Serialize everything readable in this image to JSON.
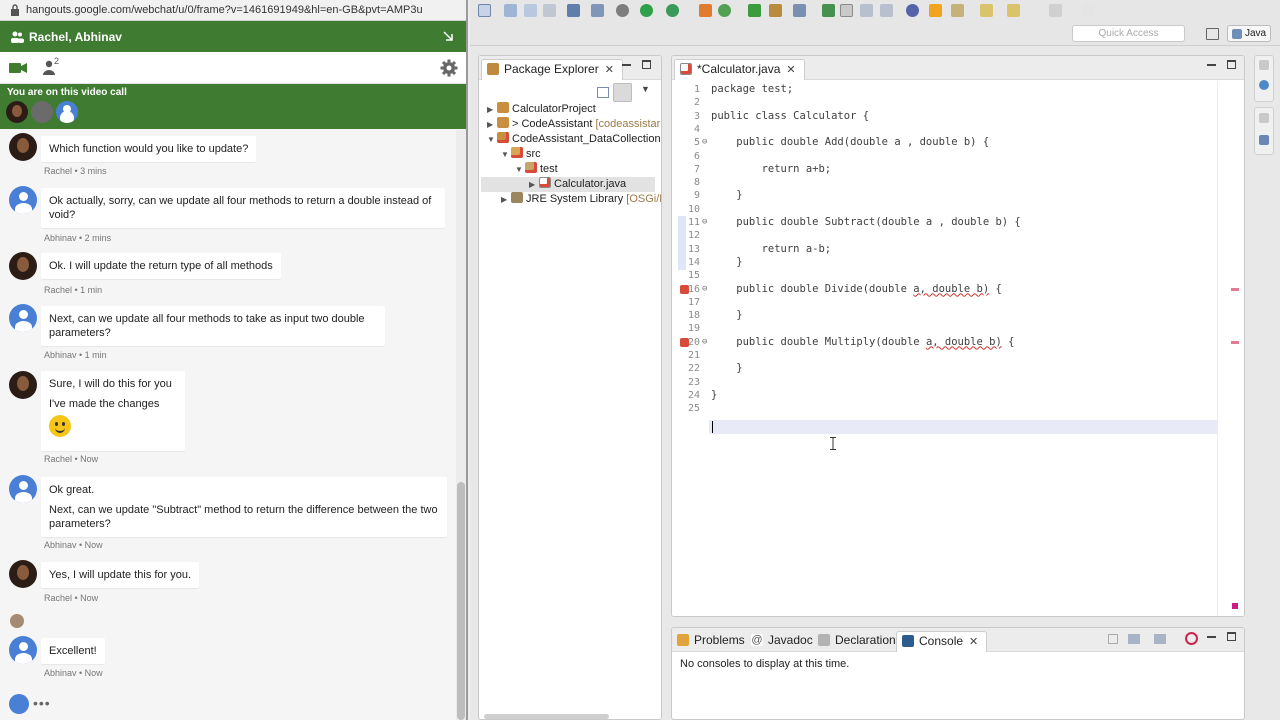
{
  "browser": {
    "url": "hangouts.google.com/webchat/u/0/frame?v=1461691949&hl=en-GB&pvt=AMP3u"
  },
  "hangouts": {
    "header_title": "Rachel, Abhinav",
    "participant_count": "2",
    "call_banner": "You are on this video call",
    "messages": [
      {
        "sender": "Rachel",
        "lines": [
          "Which function would you like to update?"
        ],
        "meta": "Rachel • 3 mins"
      },
      {
        "sender": "Abhinav",
        "lines": [
          "Ok actually, sorry, can we update all four methods to return a double instead of void?"
        ],
        "meta": "Abhinav • 2 mins"
      },
      {
        "sender": "Rachel",
        "lines": [
          "Ok. I will update the return type of all methods"
        ],
        "meta": "Rachel • 1 min"
      },
      {
        "sender": "Abhinav",
        "lines": [
          "Next, can we update all four methods to take as input two double parameters?"
        ],
        "meta": "Abhinav • 1 min"
      },
      {
        "sender": "Rachel",
        "lines": [
          "Sure, I will do this for you",
          "I've made the changes"
        ],
        "meta": "Rachel • Now"
      },
      {
        "sender": "Abhinav",
        "lines": [
          "Ok great.",
          "Next, can we update \"Subtract\" method to return the difference between the two parameters?"
        ],
        "meta": "Abhinav • Now"
      },
      {
        "sender": "Rachel",
        "lines": [
          "Yes, I will update this for you."
        ],
        "meta": "Rachel • Now"
      },
      {
        "sender": "Abhinav",
        "lines": [
          "Excellent!"
        ],
        "meta": "Abhinav • Now"
      }
    ],
    "typing_indicator": "•••"
  },
  "eclipse": {
    "quick_access_placeholder": "Quick Access",
    "perspective": "Java",
    "package_explorer": {
      "title": "Package Explorer",
      "tree": [
        {
          "label": "CalculatorProject",
          "decoration": ""
        },
        {
          "label": "> CodeAssistant",
          "decoration": "[codeassistar"
        },
        {
          "label": "CodeAssistant_DataCollection",
          "decoration": ""
        },
        {
          "label": "src",
          "decoration": ""
        },
        {
          "label": "test",
          "decoration": ""
        },
        {
          "label": "Calculator.java",
          "decoration": ""
        },
        {
          "label": "JRE System Library",
          "decoration": "[OSGi/M"
        }
      ]
    },
    "editor": {
      "tab_title": "*Calculator.java",
      "lines": [
        {
          "n": "1",
          "text": "package test;"
        },
        {
          "n": "2",
          "text": ""
        },
        {
          "n": "3",
          "text": "public class Calculator {"
        },
        {
          "n": "4",
          "text": ""
        },
        {
          "n": "5",
          "text": "    public double Add(double a , double b) {"
        },
        {
          "n": "6",
          "text": ""
        },
        {
          "n": "7",
          "text": "        return a+b;"
        },
        {
          "n": "8",
          "text": ""
        },
        {
          "n": "9",
          "text": "    }"
        },
        {
          "n": "10",
          "text": ""
        },
        {
          "n": "11",
          "text": "    public double Subtract(double a , double b) {"
        },
        {
          "n": "12",
          "text": ""
        },
        {
          "n": "13",
          "text": "        return a-b;"
        },
        {
          "n": "14",
          "text": "    }"
        },
        {
          "n": "15",
          "text": ""
        },
        {
          "n": "16",
          "text": "    public double Divide(double a, double b) {"
        },
        {
          "n": "17",
          "text": ""
        },
        {
          "n": "18",
          "text": "    }"
        },
        {
          "n": "19",
          "text": ""
        },
        {
          "n": "20",
          "text": "    public double Multiply(double a, double b) {"
        },
        {
          "n": "21",
          "text": ""
        },
        {
          "n": "22",
          "text": "    }"
        },
        {
          "n": "23",
          "text": ""
        },
        {
          "n": "24",
          "text": "}"
        },
        {
          "n": "25",
          "text": ""
        }
      ]
    },
    "bottom_panel": {
      "tabs": [
        "Problems",
        "Javadoc",
        "Declaration",
        "Console"
      ],
      "active_tab": "Console",
      "console_text": "No consoles to display at this time."
    }
  },
  "colors": {
    "hangouts_green": "#3f7c32",
    "avatar_blue": "#4a7fd6",
    "error_red": "#d84a3a"
  }
}
